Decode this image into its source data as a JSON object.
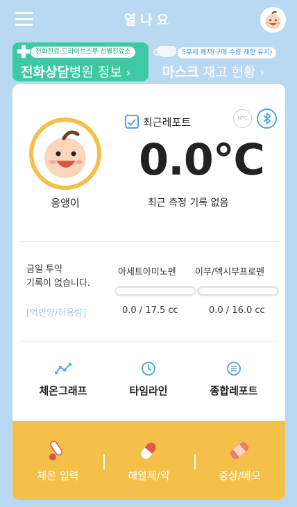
{
  "header": {
    "title": "열나요",
    "menu_icon": "hamburger-menu-icon",
    "avatar_icon": "baby-avatar-icon"
  },
  "banners": {
    "left": {
      "pill": "전화진료·드라이브스루·선별진료소",
      "title_bold": "전화상담",
      "title_rest": "병원 정보",
      "chevron": "›",
      "color": "#3cc9a4"
    },
    "right": {
      "pill": "5부제 폐지(구매 수량 제한 유지)",
      "title_bold": "마스크",
      "title_rest": " 재고 현황",
      "chevron": "›"
    }
  },
  "profile": {
    "name": "응앵이",
    "ring_color": "#f5c04a"
  },
  "temperature": {
    "report_label": "최근레포트",
    "nfc_label": "NFC",
    "value": "0.0℃",
    "status": "최근 측정 기록 없음"
  },
  "medication": {
    "today_line1": "금일 투약",
    "today_line2": "기록이 없습니다.",
    "link": "[먹인양/허용량]",
    "drugs": [
      {
        "name": "아세트아미노펜",
        "amount": "0.0 / 17.5 cc",
        "fill": 0
      },
      {
        "name": "이부/덱시부프로펜",
        "amount": "0.0 / 16.0 cc",
        "fill": 0
      }
    ]
  },
  "reports": [
    {
      "label": "체온그래프",
      "icon": "temperature-graph-icon"
    },
    {
      "label": "타임라인",
      "icon": "clock-icon"
    },
    {
      "label": "종합레포트",
      "icon": "list-icon"
    }
  ],
  "actions": [
    {
      "label": "체온 입력",
      "icon": "thermometer-icon"
    },
    {
      "label": "해열제/약",
      "icon": "pill-capsule-icon"
    },
    {
      "label": "증상/메모",
      "icon": "bandage-icon"
    }
  ],
  "colors": {
    "background": "#b9d9f3",
    "accent_blue": "#4aa3e5",
    "accent_yellow": "#f5c04a",
    "accent_green": "#3cc9a4"
  }
}
